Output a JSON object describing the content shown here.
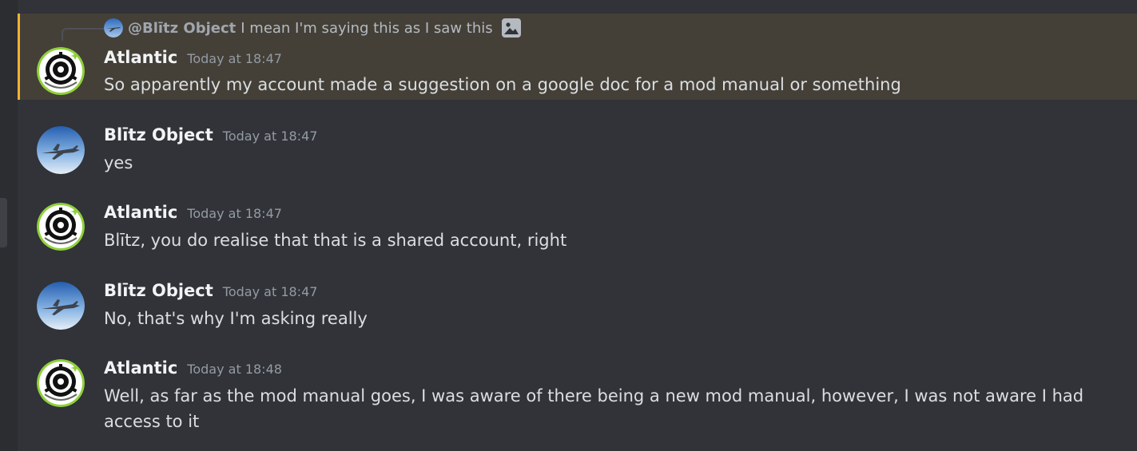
{
  "colors": {
    "background": "#313338",
    "highlight_bg": "#444038",
    "highlight_accent": "#f0b232",
    "author_name": "#f2f3f5",
    "timestamp": "#949ba4",
    "message_text": "#dbdee1"
  },
  "messages": [
    {
      "author": "Atlantic",
      "avatar_icon": "scp-logo-avatar",
      "timestamp": "Today at 18:47",
      "content": "So apparently my account made a suggestion on a google doc for a mod manual or something",
      "highlighted": true,
      "reply": {
        "author": "@Blītz Object",
        "text": "I mean I'm saying this as I saw this",
        "attachment_icon": "image-icon"
      }
    },
    {
      "author": "Blītz Object",
      "avatar_icon": "fighter-jet-avatar",
      "timestamp": "Today at 18:47",
      "content": "yes"
    },
    {
      "author": "Atlantic",
      "avatar_icon": "scp-logo-avatar",
      "timestamp": "Today at 18:47",
      "content": "Blītz, you do realise that that is a shared account, right"
    },
    {
      "author": "Blītz Object",
      "avatar_icon": "fighter-jet-avatar",
      "timestamp": "Today at 18:47",
      "content": "No, that's why I'm asking really"
    },
    {
      "author": "Atlantic",
      "avatar_icon": "scp-logo-avatar",
      "timestamp": "Today at 18:48",
      "content": "Well, as far as the mod manual goes, I was aware of there being a new mod manual, however, I was not aware I had access to it"
    }
  ]
}
